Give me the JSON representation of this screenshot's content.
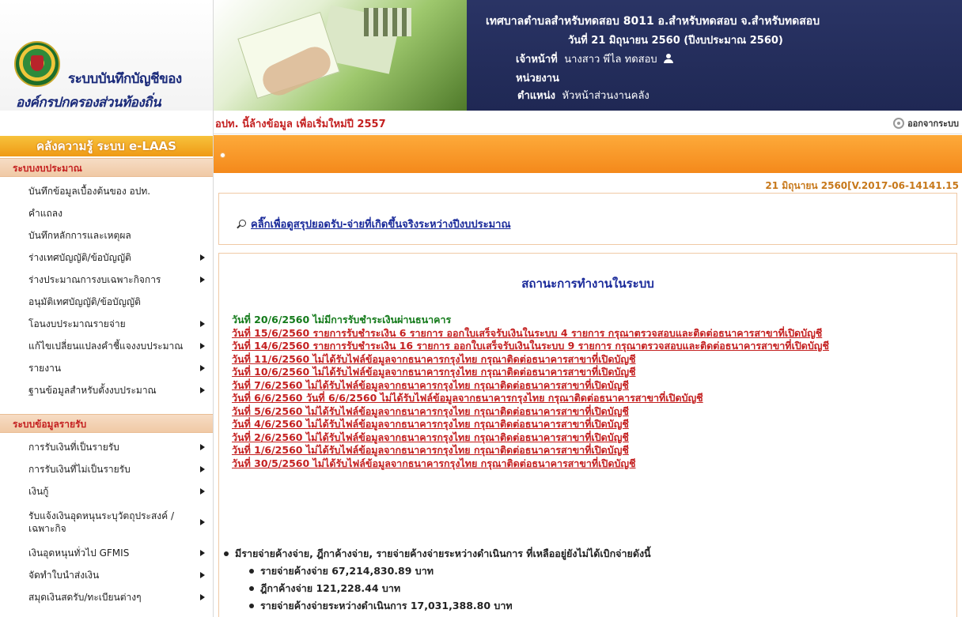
{
  "logo": {
    "line1": "ระบบบันทึกบัญชีของ",
    "line2": "องค์กรปกครองส่วนท้องถิ่น"
  },
  "header": {
    "org": "เทศบาลตำบลสำหรับทดสอบ 8011 อ.สำหรับทดสอบ จ.สำหรับทดสอบ",
    "date": "วันที่ 21 มิถุนายน 2560  (ปีงบประมาณ 2560)",
    "officer_label": "เจ้าหน้าที่",
    "officer_name": "นางสาว พีไล ทดสอบ",
    "unit_label": "หน่วยงาน",
    "position_label": "ตำแหน่ง",
    "position_value": "หัวหน้าส่วนงานคลัง",
    "user_icon": "user-icon"
  },
  "notice": "อปท. นี้ล้างข้อมูล เพื่อเริ่มใหม่ปี 2557",
  "logout_label": "ออกจากระบบ",
  "sidebar": {
    "kb_title": "คลังความรู้ ระบบ e-LAAS",
    "section1": "ระบบงบประมาณ",
    "budget_items": [
      {
        "label": "บันทึกข้อมูลเบื้องต้นของ อปท.",
        "arrow": false
      },
      {
        "label": "คำแถลง",
        "arrow": false
      },
      {
        "label": "บันทึกหลักการและเหตุผล",
        "arrow": false
      },
      {
        "label": "ร่างเทศบัญญัติ/ข้อบัญญัติ",
        "arrow": true
      },
      {
        "label": "ร่างประมาณการงบเฉพาะกิจการ",
        "arrow": true
      },
      {
        "label": "อนุมัติเทศบัญญัติ/ข้อบัญญัติ",
        "arrow": false
      },
      {
        "label": "โอนงบประมาณรายจ่าย",
        "arrow": true
      },
      {
        "label": "แก้ไขเปลี่ยนแปลงคำชี้แจงงบประมาณ",
        "arrow": true
      },
      {
        "label": "รายงาน",
        "arrow": true
      },
      {
        "label": "ฐานข้อมูลสำหรับตั้งงบประมาณ",
        "arrow": true
      }
    ],
    "section2": "ระบบข้อมูลรายรับ",
    "revenue_items": [
      {
        "label": "การรับเงินที่เป็นรายรับ",
        "arrow": true
      },
      {
        "label": "การรับเงินที่ไม่เป็นรายรับ",
        "arrow": true
      },
      {
        "label": "เงินกู้",
        "arrow": true
      },
      {
        "label": "รับแจ้งเงินอุดหนุนระบุวัตถุประสงค์ / เฉพาะกิจ",
        "arrow": true
      },
      {
        "label": "เงินอุดหนุนทั่วไป GFMIS",
        "arrow": true
      },
      {
        "label": "จัดทำใบนำส่งเงิน",
        "arrow": true
      },
      {
        "label": "สมุดเงินสดรับ/ทะเบียนต่างๆ",
        "arrow": true
      }
    ]
  },
  "version": "21 มิถุนายน 2560[V.2017-06-14141.15",
  "summary_link": "คลิ๊กเพื่อดูสรุปยอดรับ-จ่ายที่เกิดขึ้นจริงระหว่างปีงบประมาณ",
  "status_title": "สถานะการทำงานในระบบ",
  "notes": [
    {
      "text": "วันที่ 20/6/2560 ไม่มีการรับชำระเงินผ่านธนาคาร",
      "style": "green"
    },
    {
      "text": "วันที่ 15/6/2560 รายการรับชำระเงิน 6 รายการ ออกใบเสร็จรับเงินในระบบ 4 รายการ กรุณาตรวจสอบและติดต่อธนาคารสาขาที่เปิดบัญชี",
      "style": "red"
    },
    {
      "text": "วันที่ 14/6/2560 รายการรับชำระเงิน 16 รายการ ออกใบเสร็จรับเงินในระบบ 9 รายการ กรุณาตรวจสอบและติดต่อธนาคารสาขาที่เปิดบัญชี",
      "style": "red"
    },
    {
      "text": "วันที่ 11/6/2560 ไม่ได้รับไฟล์ข้อมูลจากธนาคารกรุงไทย กรุณาติดต่อธนาคารสาขาที่เปิดบัญชี",
      "style": "red"
    },
    {
      "text": "วันที่ 10/6/2560 ไม่ได้รับไฟล์ข้อมูลจากธนาคารกรุงไทย กรุณาติดต่อธนาคารสาขาที่เปิดบัญชี",
      "style": "red"
    },
    {
      "text": "วันที่ 7/6/2560 ไม่ได้รับไฟล์ข้อมูลจากธนาคารกรุงไทย กรุณาติดต่อธนาคารสาขาที่เปิดบัญชี",
      "style": "red"
    },
    {
      "text": "วันที่ 6/6/2560 วันที่ 6/6/2560 ไม่ได้รับไฟล์ข้อมูลจากธนาคารกรุงไทย กรุณาติดต่อธนาคารสาขาที่เปิดบัญชี",
      "style": "red"
    },
    {
      "text": "วันที่ 5/6/2560 ไม่ได้รับไฟล์ข้อมูลจากธนาคารกรุงไทย กรุณาติดต่อธนาคารสาขาที่เปิดบัญชี",
      "style": "red"
    },
    {
      "text": "วันที่ 4/6/2560 ไม่ได้รับไฟล์ข้อมูลจากธนาคารกรุงไทย กรุณาติดต่อธนาคารสาขาที่เปิดบัญชี",
      "style": "red"
    },
    {
      "text": "วันที่ 2/6/2560 ไม่ได้รับไฟล์ข้อมูลจากธนาคารกรุงไทย กรุณาติดต่อธนาคารสาขาที่เปิดบัญชี",
      "style": "red"
    },
    {
      "text": "วันที่ 1/6/2560 ไม่ได้รับไฟล์ข้อมูลจากธนาคารกรุงไทย กรุณาติดต่อธนาคารสาขาที่เปิดบัญชี",
      "style": "red"
    },
    {
      "text": "วันที่ 30/5/2560 ไม่ได้รับไฟล์ข้อมูลจากธนาคารกรุงไทย กรุณาติดต่อธนาคารสาขาที่เปิดบัญชี",
      "style": "red"
    }
  ],
  "summary": {
    "main": "มีรายจ่ายค้างจ่าย, ฎีกาค้างจ่าย, รายจ่ายค้างจ่ายระหว่างดำเนินการ ที่เหลืออยู่ยังไม่ได้เบิกจ่ายดังนี้",
    "items": [
      "รายจ่ายค้างจ่าย 67,214,830.89 บาท",
      "ฎีกาค้างจ่าย 121,228.44 บาท",
      "รายจ่ายค้างจ่ายระหว่างดำเนินการ 17,031,388.80 บาท"
    ]
  }
}
